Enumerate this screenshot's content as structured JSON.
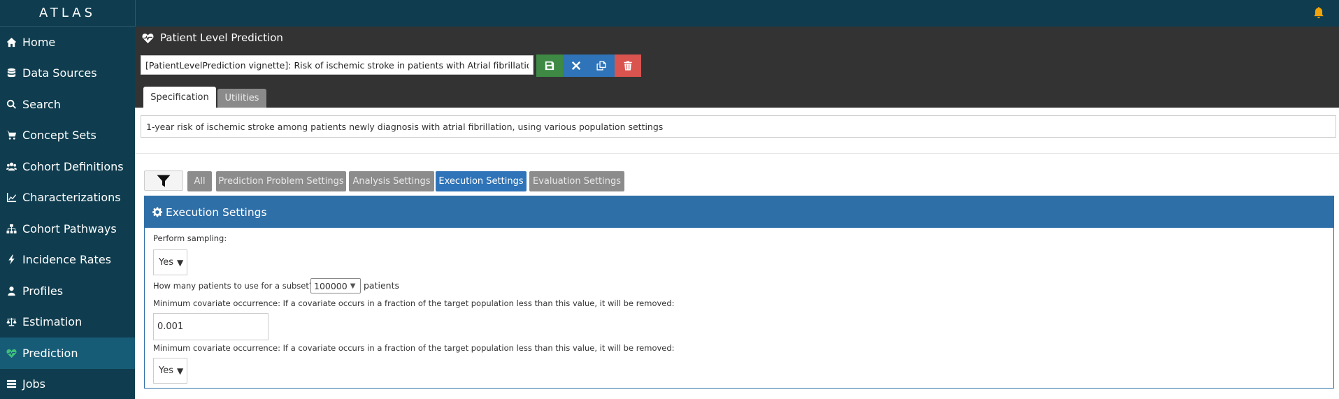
{
  "app": {
    "brand": "ATLAS"
  },
  "sidebar": {
    "items": [
      {
        "label": "Home",
        "icon": "home-icon"
      },
      {
        "label": "Data Sources",
        "icon": "database-icon"
      },
      {
        "label": "Search",
        "icon": "search-icon"
      },
      {
        "label": "Concept Sets",
        "icon": "shopping-cart-icon"
      },
      {
        "label": "Cohort Definitions",
        "icon": "users-icon"
      },
      {
        "label": "Characterizations",
        "icon": "line-chart-icon"
      },
      {
        "label": "Cohort Pathways",
        "icon": "sitemap-icon"
      },
      {
        "label": "Incidence Rates",
        "icon": "bolt-icon"
      },
      {
        "label": "Profiles",
        "icon": "user-icon"
      },
      {
        "label": "Estimation",
        "icon": "balance-scale-icon"
      },
      {
        "label": "Prediction",
        "icon": "heartbeat-icon",
        "active": true
      },
      {
        "label": "Jobs",
        "icon": "tasks-icon"
      }
    ]
  },
  "header": {
    "title": "Patient Level Prediction",
    "name_value": "[PatientLevelPrediction vignette]: Risk of ischemic stroke in patients with Atrial fibrillation",
    "tabs": [
      "Specification",
      "Utilities"
    ]
  },
  "description": "1-year risk of ischemic stroke among patients newly diagnosis with atrial fibrillation, using various population settings",
  "filters": [
    "All",
    "Prediction Problem Settings",
    "Analysis Settings",
    "Execution Settings",
    "Evaluation Settings"
  ],
  "panel": {
    "title": "Execution Settings",
    "perform_sampling_label": "Perform sampling:",
    "perform_sampling_value": "Yes",
    "subset_label": "How many patients to use for a subset?",
    "subset_value": "100000",
    "subset_suffix": "patients",
    "min_cov_label": "Minimum covariate occurrence: If a covariate occurs in a fraction of the target population less than this value, it will be removed:",
    "min_cov_value": "0.001",
    "min_cov_label_2": "Minimum covariate occurrence: If a covariate occurs in a fraction of the target population less than this value, it will be removed:",
    "second_select_value": "Yes"
  },
  "colors": {
    "sidebar_bg": "#0f3d4f",
    "sidebar_active": "#175c77",
    "header_bg": "#333333",
    "primary": "#2f74b8",
    "success": "#3e8a45",
    "danger": "#d9534f",
    "bell": "#f0a30a"
  }
}
